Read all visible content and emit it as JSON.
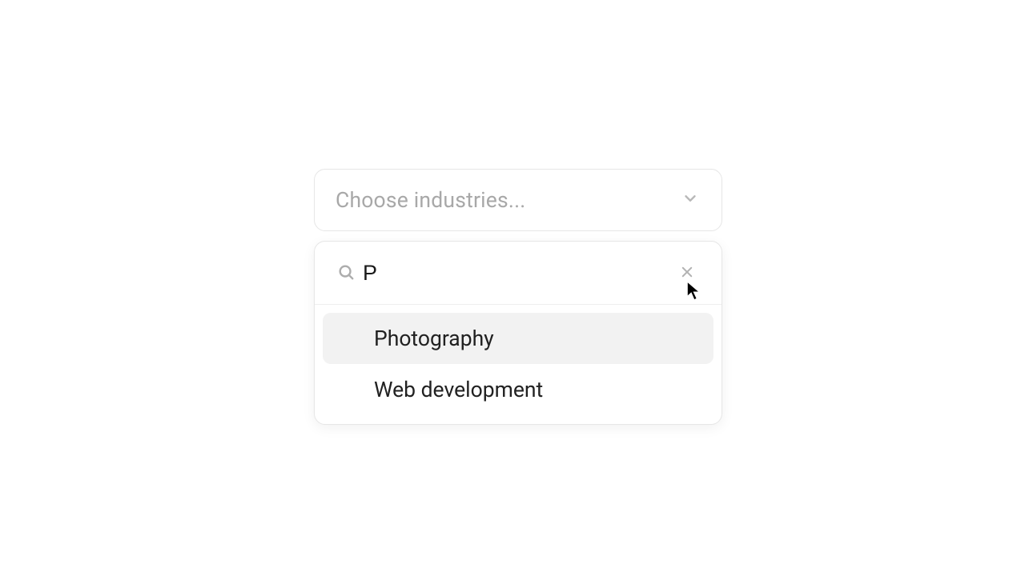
{
  "multiselect": {
    "placeholder": "Choose industries..."
  },
  "search": {
    "value": "P",
    "placeholder": ""
  },
  "options": [
    {
      "label": "Photography",
      "focused": true
    },
    {
      "label": "Web development",
      "focused": false
    }
  ]
}
